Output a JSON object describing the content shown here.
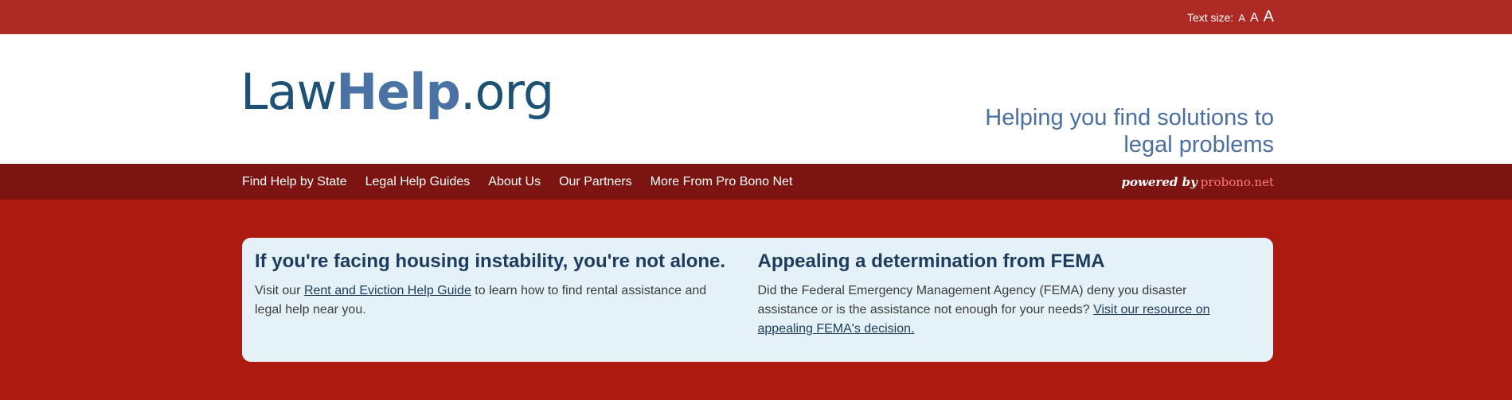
{
  "topbar": {
    "text_size_label": "Text size:",
    "sizes": [
      "A",
      "A",
      "A"
    ]
  },
  "header": {
    "logo": {
      "part1": "Law",
      "part2": "Help",
      "part3": ".org"
    },
    "tagline": "Helping you find solutions to legal problems"
  },
  "nav": {
    "items": [
      {
        "label": "Find Help by State"
      },
      {
        "label": "Legal Help Guides"
      },
      {
        "label": "About Us"
      },
      {
        "label": "Our Partners"
      },
      {
        "label": "More From Pro Bono Net"
      }
    ],
    "powered_by": "powered by",
    "powered_brand": "probono.net"
  },
  "alerts": [
    {
      "title": "If you're facing housing instability, you're not alone.",
      "text_before": "Visit our ",
      "link": "Rent and Eviction Help Guide",
      "text_after": " to learn how to find rental assistance and legal help near you."
    },
    {
      "title": "Appealing a determination from FEMA",
      "text_before": "Did the Federal Emergency Management Agency (FEMA) deny you disaster assistance or is the assistance not enough for your needs? ",
      "link": "Visit our resource on appealing FEMA's decision.",
      "text_after": ""
    }
  ],
  "colors": {
    "topbar": "#ad2a25",
    "navbar": "#7c1511",
    "page_bg": "#ad1a10",
    "card_bg": "#e4f2f7",
    "logo_dark": "#1d5276",
    "logo_light": "#4a72a4"
  }
}
